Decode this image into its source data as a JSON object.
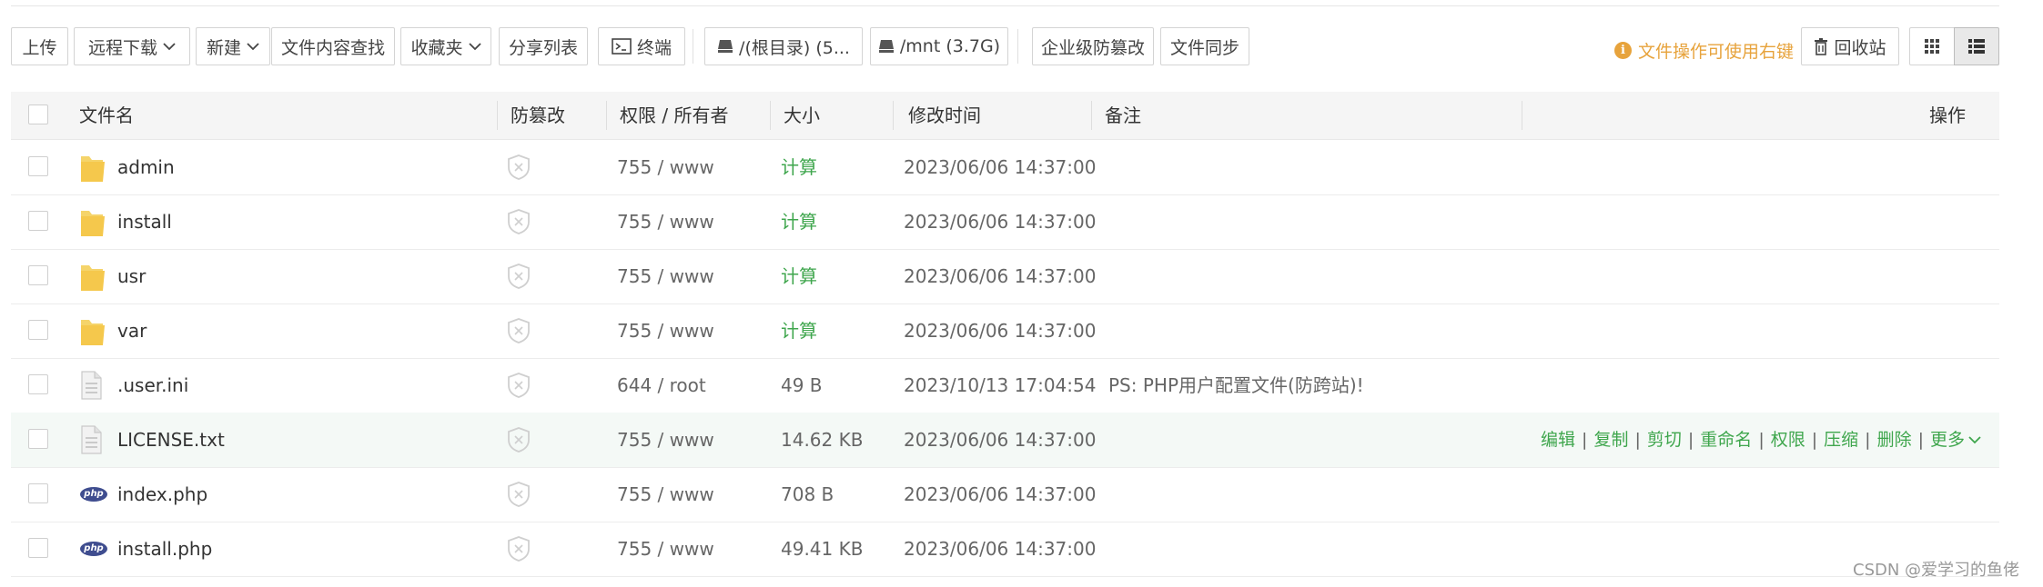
{
  "toolbar": {
    "upload": "上传",
    "remote_download": "远程下载",
    "new": "新建",
    "content_search": "文件内容查找",
    "favorites": "收藏夹",
    "share_list": "分享列表",
    "terminal": "终端",
    "disk_root": "/(根目录) (5...",
    "disk_mnt": "/mnt (3.7G)",
    "tamper_proof": "企业级防篡改",
    "file_sync": "文件同步",
    "tip": "文件操作可使用右键",
    "recycle_bin": "回收站"
  },
  "table": {
    "headers": {
      "name": "文件名",
      "tamper": "防篡改",
      "perm": "权限 / 所有者",
      "size": "大小",
      "mtime": "修改时间",
      "note": "备注",
      "actions": "操作"
    },
    "rows": [
      {
        "type": "folder",
        "name": "admin",
        "perm": "755 / www",
        "size": "计算",
        "mtime": "2023/06/06 14:37:00",
        "note": ""
      },
      {
        "type": "folder",
        "name": "install",
        "perm": "755 / www",
        "size": "计算",
        "mtime": "2023/06/06 14:37:00",
        "note": ""
      },
      {
        "type": "folder",
        "name": "usr",
        "perm": "755 / www",
        "size": "计算",
        "mtime": "2023/06/06 14:37:00",
        "note": ""
      },
      {
        "type": "folder",
        "name": "var",
        "perm": "755 / www",
        "size": "计算",
        "mtime": "2023/06/06 14:37:00",
        "note": ""
      },
      {
        "type": "file",
        "name": ".user.ini",
        "perm": "644 / root",
        "size": "49 B",
        "mtime": "2023/10/13 17:04:54",
        "note": "PS: PHP用户配置文件(防跨站)!"
      },
      {
        "type": "file",
        "name": "LICENSE.txt",
        "perm": "755 / www",
        "size": "14.62 KB",
        "mtime": "2023/06/06 14:37:00",
        "note": ""
      },
      {
        "type": "php",
        "name": "index.php",
        "perm": "755 / www",
        "size": "708 B",
        "mtime": "2023/06/06 14:37:00",
        "note": ""
      },
      {
        "type": "php",
        "name": "install.php",
        "perm": "755 / www",
        "size": "49.41 KB",
        "mtime": "2023/06/06 14:37:00",
        "note": ""
      }
    ],
    "row_actions": [
      "编辑",
      "复制",
      "剪切",
      "重命名",
      "权限",
      "压缩",
      "删除",
      "更多"
    ]
  },
  "php_badge": "php",
  "watermark": "CSDN @爱学习的鱼佬",
  "colors": {
    "accent_green": "#3fa64d",
    "tip_orange": "#e7a33c",
    "folder_yellow": "#f5c84c",
    "php_blue": "#3f4d8f"
  }
}
